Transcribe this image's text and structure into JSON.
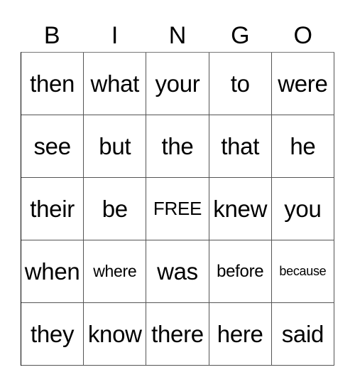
{
  "header": [
    "B",
    "I",
    "N",
    "G",
    "O"
  ],
  "cells": [
    "then",
    "what",
    "your",
    "to",
    "were",
    "see",
    "but",
    "the",
    "that",
    "he",
    "their",
    "be",
    "FREE",
    "knew",
    "you",
    "when",
    "where",
    "was",
    "before",
    "because",
    "they",
    "know",
    "there",
    "here",
    "said"
  ]
}
